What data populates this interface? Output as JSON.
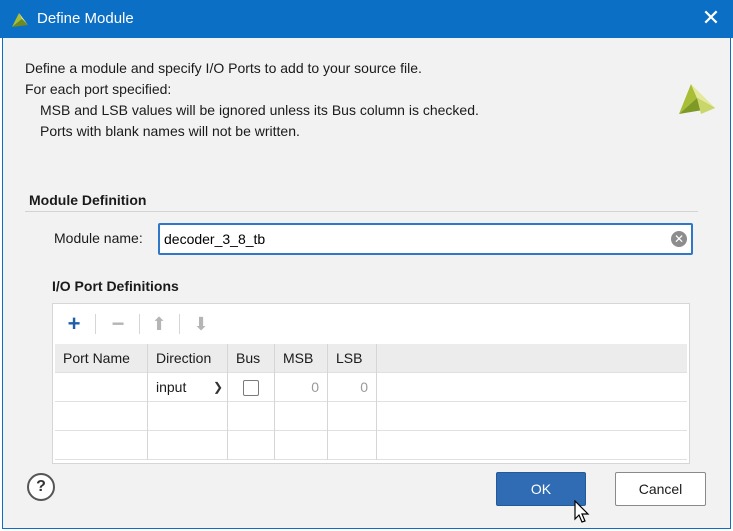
{
  "window": {
    "title": "Define Module",
    "close_icon": "close-icon"
  },
  "intro": {
    "line1": "Define a module and specify I/O Ports to add to your source file.",
    "line2": "For each port specified:",
    "line3": "MSB and LSB values will be ignored unless its Bus column is checked.",
    "line4": "Ports with blank names will not be written."
  },
  "module_definition": {
    "section_title": "Module Definition",
    "name_label": "Module name:",
    "name_value": "decoder_3_8_tb"
  },
  "io_ports": {
    "section_title": "I/O Port Definitions",
    "toolbar": [
      "add-icon",
      "remove-icon",
      "move-up-icon",
      "move-down-icon"
    ],
    "columns": [
      "Port Name",
      "Direction",
      "Bus",
      "MSB",
      "LSB"
    ],
    "rows": [
      {
        "port_name": "",
        "direction": "input",
        "bus": false,
        "msb": "0",
        "lsb": "0"
      }
    ]
  },
  "buttons": {
    "help": "?",
    "ok": "OK",
    "cancel": "Cancel"
  },
  "colors": {
    "title_bar": "#0b6fc6",
    "ok_button": "#2f6cb3",
    "focus_border": "#2e77c9",
    "logo_green": "#a9be37"
  }
}
